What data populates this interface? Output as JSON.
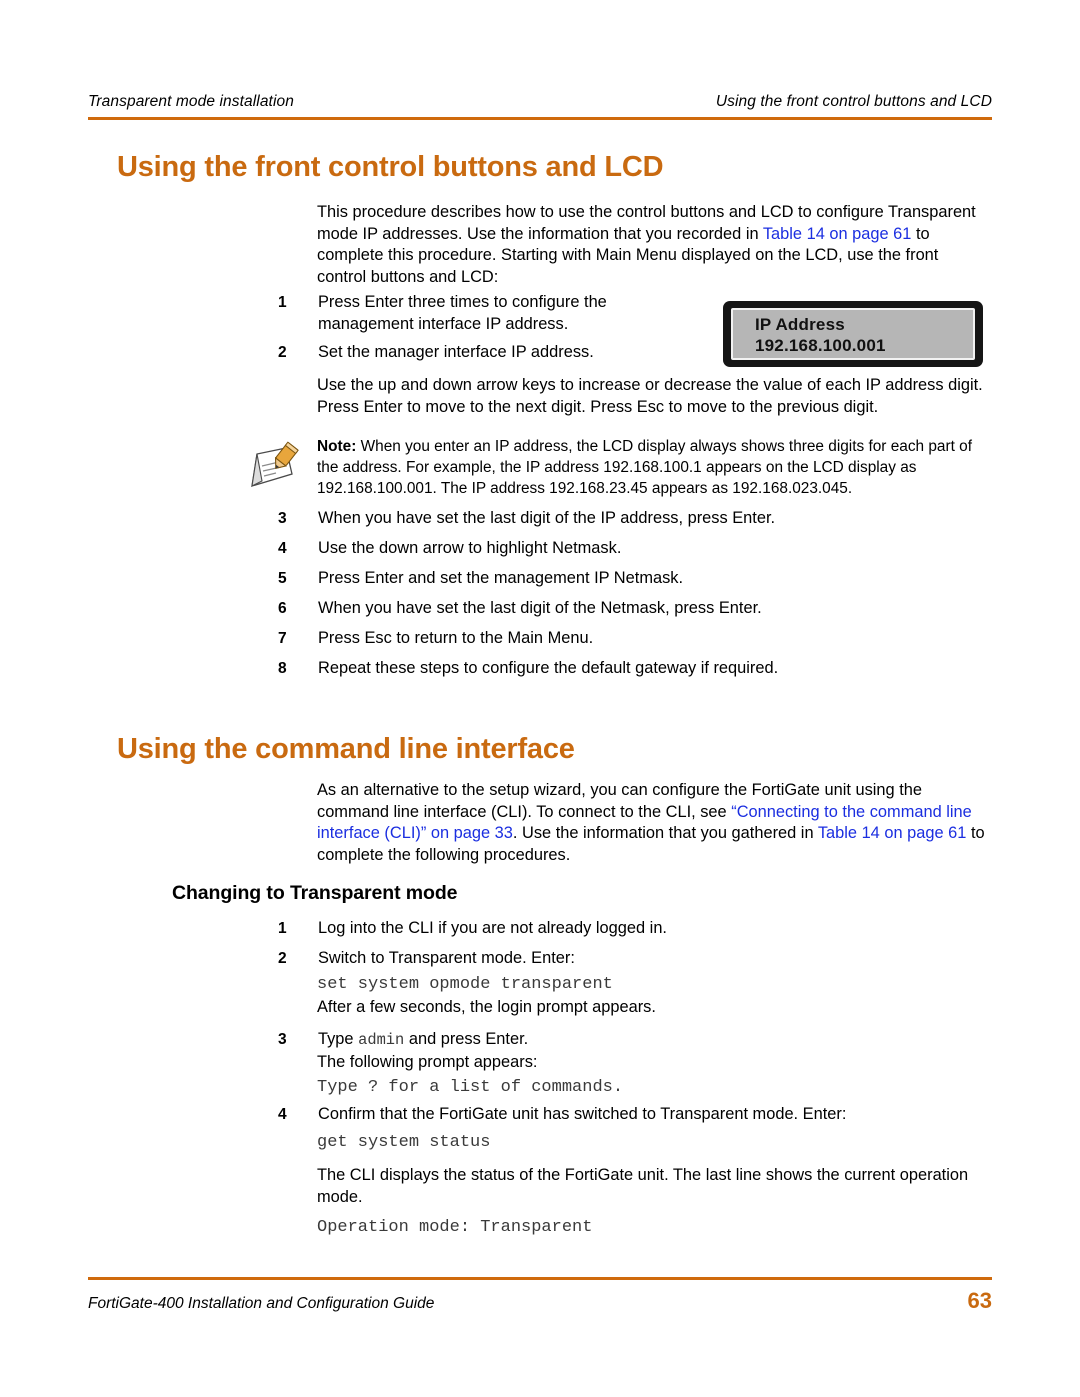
{
  "header": {
    "left": "Transparent mode installation",
    "right": "Using the front control buttons and LCD"
  },
  "sections": {
    "lcd": {
      "heading": "Using the front control buttons and LCD",
      "intro_1": "This procedure describes how to use the control buttons and LCD to configure Transparent mode IP addresses. Use the information that you recorded in ",
      "intro_link_1": "Table 14 on page 61",
      "intro_2": " to complete this procedure. Starting with Main Menu displayed on the LCD, use the front control buttons and LCD:",
      "steps_a": [
        {
          "num": "1",
          "text": "Press Enter three times to configure the management interface IP address."
        },
        {
          "num": "2",
          "text": "Set the manager interface IP address."
        }
      ],
      "mid_para": "Use the up and down arrow keys to increase or decrease the value of each IP address digit. Press Enter to move to the next digit. Press Esc to move to the previous digit.",
      "note": {
        "label": "Note:",
        "text": " When you enter an IP address, the LCD display always shows three digits for each part of the address. For example, the IP address 192.168.100.1 appears on the LCD display as 192.168.100.001. The IP address 192.168.23.45 appears as 192.168.023.045."
      },
      "lcd_panel": {
        "line1": "IP Address",
        "line2": "192.168.100.001"
      },
      "steps_b": [
        {
          "num": "3",
          "text": "When you have set the last digit of the IP address, press Enter."
        },
        {
          "num": "4",
          "text": "Use the down arrow to highlight Netmask."
        },
        {
          "num": "5",
          "text": "Press Enter and set the management IP Netmask."
        },
        {
          "num": "6",
          "text": "When you have set the last digit of the Netmask, press Enter."
        },
        {
          "num": "7",
          "text": "Press Esc to return to the Main Menu."
        },
        {
          "num": "8",
          "text": "Repeat these steps to configure the default gateway if required."
        }
      ]
    },
    "cli": {
      "heading": "Using the command line interface",
      "intro_1": "As an alternative to the setup wizard, you can configure the FortiGate unit using the command line interface (CLI). To connect to the CLI, see ",
      "intro_link_1": "“Connecting to the command line interface (CLI)” on page 33",
      "intro_2": ". Use the information that you gathered in ",
      "intro_link_2": "Table 14 on page 61",
      "intro_3": " to complete the following procedures.",
      "subheading": "Changing to Transparent mode",
      "step1_num": "1",
      "step1_text": "Log into the CLI if you are not already logged in.",
      "step2_num": "2",
      "step2_text": "Switch to Transparent mode. Enter:",
      "code1": "set system opmode transparent",
      "after_code1": "After a few seconds, the login prompt appears.",
      "step3_num": "3",
      "step3_a": "Type ",
      "step3_code": "admin",
      "step3_b": " and press Enter.",
      "step3_line2": "The following prompt appears:",
      "code2": "Type ? for a list of commands.",
      "step4_num": "4",
      "step4_text": "Confirm that the FortiGate unit has switched to Transparent mode. Enter:",
      "code3": "get system status",
      "closing_para": "The CLI displays the status of the FortiGate unit. The last line shows the current operation mode.",
      "code4": "Operation mode: Transparent"
    }
  },
  "footer": {
    "left": "FortiGate-400 Installation and Configuration Guide",
    "page": "63"
  },
  "colors": {
    "accent_orange": "#c96a10",
    "link_blue": "#1b2ee0",
    "code_gray": "#3a3a3a",
    "lcd_screen": "#b6b6b6"
  }
}
